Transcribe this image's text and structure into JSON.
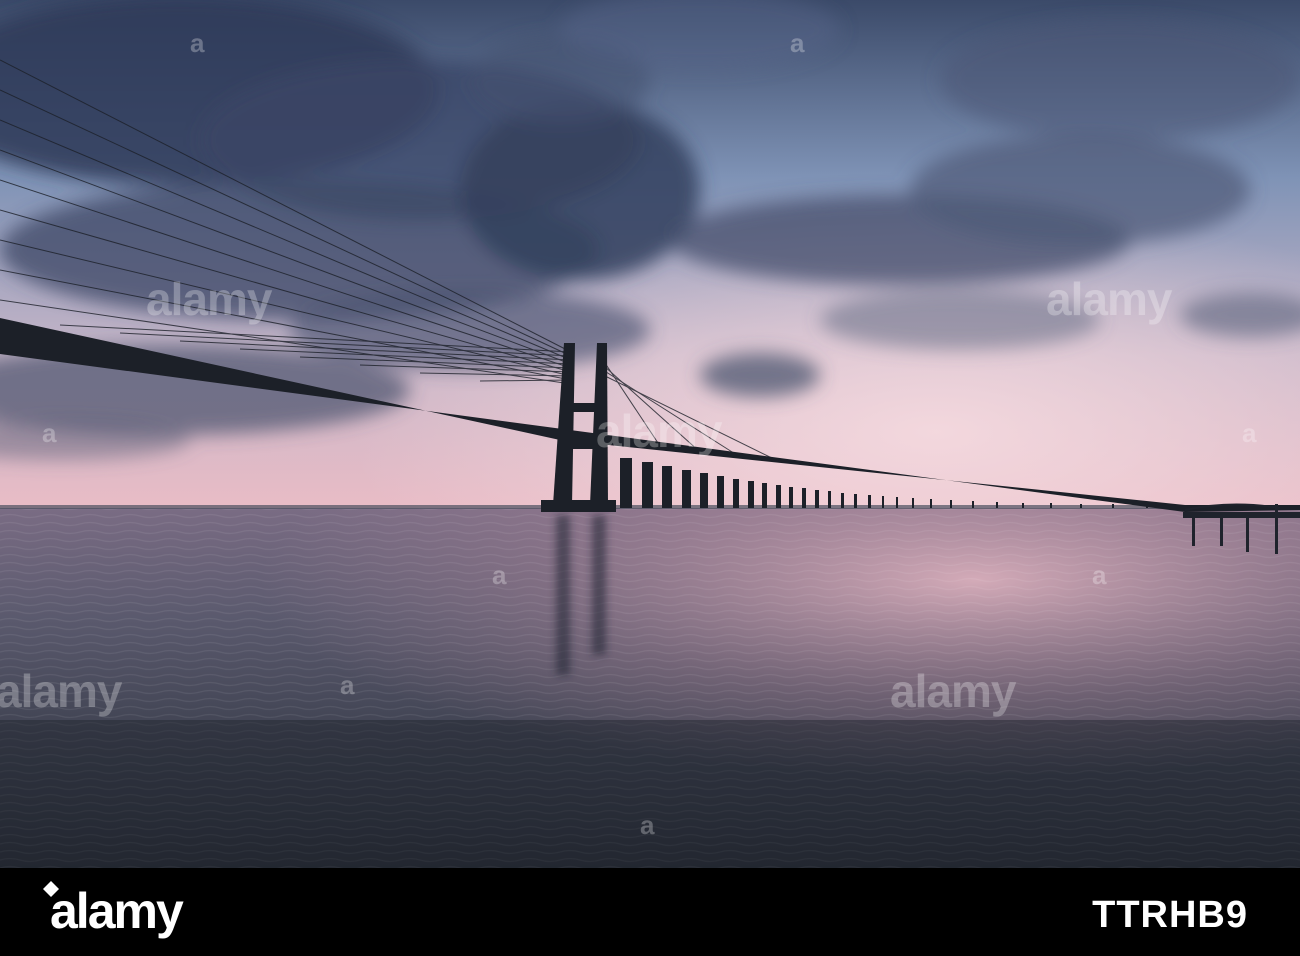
{
  "scene": {
    "colors": {
      "sky_top": "#3d4d6e",
      "sky_mid": "#9fb3cf",
      "sky_horizon": "#e6b9c3",
      "water_near": "#2e3340",
      "water_far": "#b98d9d",
      "silhouette": "#1c2028"
    }
  },
  "watermark": {
    "text": "alamy",
    "symbol": "a"
  },
  "footer": {
    "logo": "alamy",
    "image_id": "TTRHB9"
  }
}
